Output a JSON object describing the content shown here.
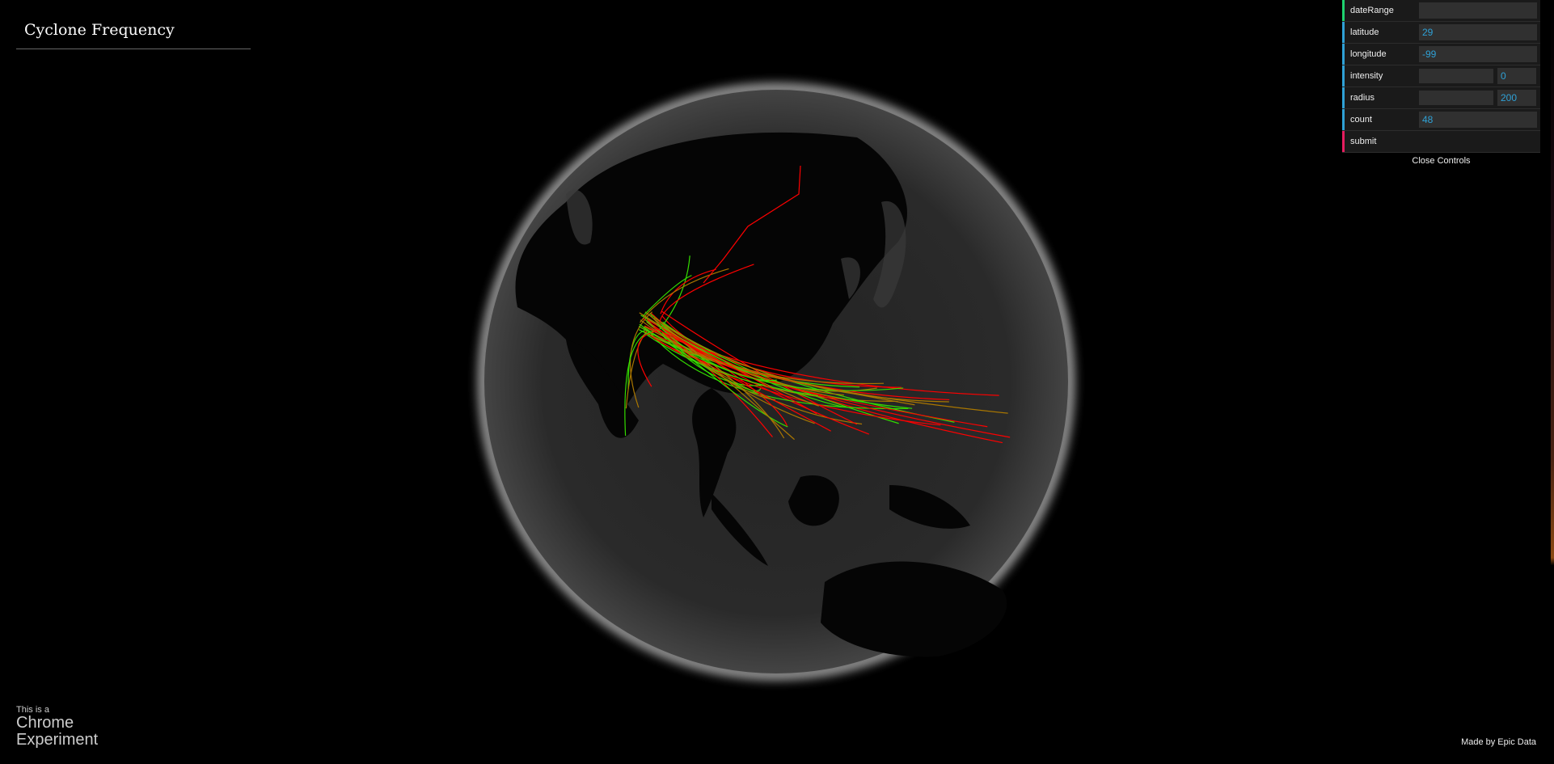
{
  "header": {
    "title": "Cyclone Frequency"
  },
  "controls": {
    "dateRange": {
      "label": "dateRange",
      "value": ""
    },
    "latitude": {
      "label": "latitude",
      "value": "29"
    },
    "longitude": {
      "label": "longitude",
      "value": "-99"
    },
    "intensity": {
      "label": "intensity",
      "value": "0",
      "fill_fraction": 0
    },
    "radius": {
      "label": "radius",
      "value": "200",
      "fill_fraction": 0
    },
    "count": {
      "label": "count",
      "value": "48"
    },
    "submit": {
      "label": "submit"
    },
    "close_label": "Close Controls",
    "colors": {
      "string": "#1ed36f",
      "number": "#2fa1d6",
      "function": "#e61d5f"
    }
  },
  "footer": {
    "badge_line1": "This is a",
    "badge_line2": "Chrome",
    "badge_line3": "Experiment",
    "credit": "Made by Epic Data"
  },
  "globe": {
    "track_colors": [
      "#ff0000",
      "#33dd00",
      "#aa7700"
    ],
    "track_count": 48
  }
}
